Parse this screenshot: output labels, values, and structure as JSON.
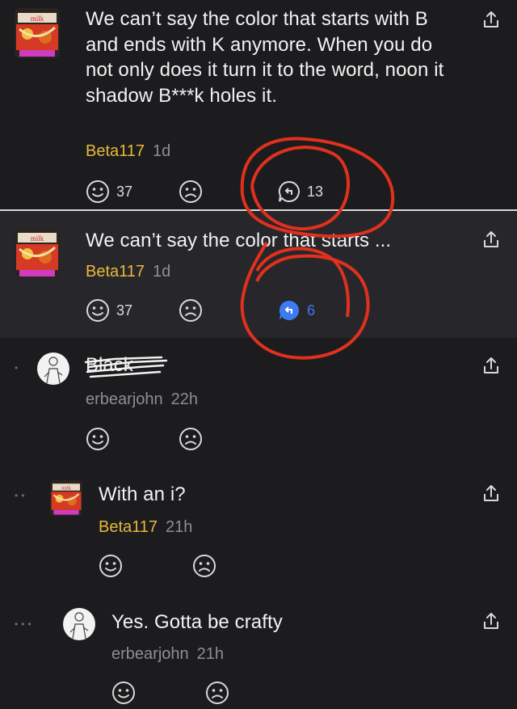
{
  "comments": [
    {
      "text": "We can’t say the color that starts with B and ends with K anymore. When you do not only does it turn it to the word, noon it shadow B***k holes it.",
      "author": "Beta117",
      "age": "1d",
      "likes": "37",
      "replies": "13"
    },
    {
      "text": "We can’t say the color that starts ...",
      "author": "Beta117",
      "age": "1d",
      "likes": "37",
      "replies": "6"
    },
    {
      "text": "Black",
      "author": "erbearjohn",
      "age": "22h"
    },
    {
      "text": "With an i?",
      "author": "Beta117",
      "age": "21h"
    },
    {
      "text": "Yes. Gotta be crafty",
      "author": "erbearjohn",
      "age": "21h"
    }
  ],
  "icons": {
    "like": "smile-icon",
    "dislike": "frown-icon",
    "reply": "reply-bubble-icon",
    "share": "share-icon"
  },
  "colors": {
    "background": "#1c1c1f",
    "author_accent": "#e9b83a",
    "reply_blue": "#3d7bf2",
    "annotation_red": "#e0301e"
  },
  "avatar_labels": {
    "milk": "milk"
  }
}
